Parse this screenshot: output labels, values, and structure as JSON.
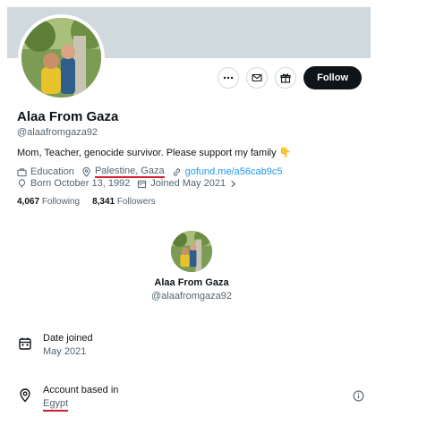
{
  "profile": {
    "name": "Alaa From Gaza",
    "handle": "@alaafromgaza92",
    "bio": "Mom, Teacher,  genocide survivor. Please support my family",
    "bio_emoji": "👇",
    "follow_label": "Follow",
    "category": "Education",
    "location": "Palestine, Gaza",
    "website": "gofund.me/a56cab9c5",
    "born": "Born October 13, 1992",
    "joined": "Joined May 2021",
    "following_count": "4,067",
    "following_label": "Following",
    "followers_count": "8,341",
    "followers_label": "Followers",
    "icons": [
      "more-icon",
      "message-icon",
      "gift-icon",
      "briefcase-icon",
      "location-pin-icon",
      "link-icon",
      "balloon-icon",
      "calendar-icon",
      "chevron-right-icon"
    ]
  },
  "about": {
    "name": "Alaa From Gaza",
    "handle": "@alaafromgaza92",
    "date_joined_label": "Date joined",
    "date_joined_value": "May 2021",
    "account_based_label": "Account based in",
    "account_based_value": "Egypt",
    "icons": [
      "calendar-icon",
      "location-pin-icon",
      "info-icon"
    ]
  },
  "colors": {
    "banner": "#cfd9de",
    "accent_link": "#1d9bf0",
    "highlight_underline": "#d01f2f",
    "follow_button": "#0f1419"
  }
}
